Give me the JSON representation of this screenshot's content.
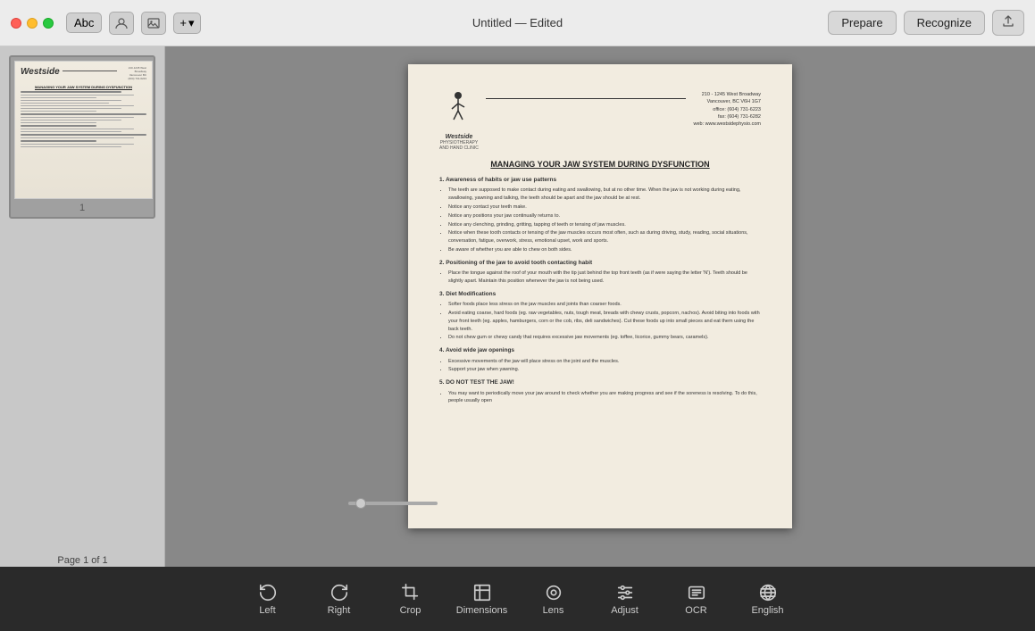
{
  "titlebar": {
    "title": "Untitled — Edited",
    "toolbar_text_btn": "Abc",
    "traffic_lights": [
      "close",
      "minimize",
      "maximize"
    ]
  },
  "header_buttons": {
    "prepare": "Prepare",
    "recognize": "Recognize",
    "share": "↑"
  },
  "document": {
    "title": "MANAGING YOUR JAW SYSTEM DURING DYSFUNCTION",
    "company": "Westside",
    "company_sub": "PHYSIOTHERAPY\nAND HAND CLINIC",
    "address_line1": "210 - 1245 West Broadway",
    "address_line2": "Vancouver, BC V6H 1G7",
    "address_line3": "office: (604) 731-6223",
    "address_line4": "fax: (604) 731-6282",
    "address_line5": "web: www.westsidephysio.com",
    "section1_title": "1. Awareness of habits or jaw use patterns",
    "section1_bullets": [
      "The teeth are supposed to make contact during eating and swallowing, but at no other time. When the jaw is not working during eating, swallowing, yawning and talking, the teeth should be apart and the jaw should be at rest.",
      "Notice any contact your teeth make.",
      "Notice any positions your jaw continually returns to.",
      "Notice any clenching, grinding, gritting, tapping of teeth or tensing of jaw muscles.",
      "Notice when these tooth contacts or tensing of the jaw muscles occurs most often, such as during driving, study, reading, social situations, conversation, fatigue, overwork, stress, emotional upset, work and sports.",
      "Be aware of whether you are able to chew on both sides."
    ],
    "section2_title": "2. Positioning of the jaw to avoid tooth contacting habit",
    "section2_bullets": [
      "Place the tongue against the roof of your mouth with the tip just behind the top front teeth (as if were saying the letter 'N'). Teeth should be slightly apart. Maintain this position whenever the jaw is not being used."
    ],
    "section3_title": "3. Diet Modifications",
    "section3_bullets": [
      "Softer foods place less stress on the jaw muscles and joints than coarser foods.",
      "Avoid eating coarse, hard foods (eg. raw vegetables, nuts, tough meat, breads with chewy crusts, popcorn, nachos). Avoid biting into foods with your front teeth (eg. apples, hamburgers, corn or the cob, ribs, deli sandwiches). Cut these foods up into small pieces and eat them using the back teeth.",
      "Do not chew gum or chewy candy that requires excessive jaw movements (eg. toffee, licorice, gummy bears, caramels)."
    ],
    "section4_title": "4. Avoid wide jaw openings",
    "section4_bullets": [
      "Excessive movements of the jaw will place stress on the joint and the muscles.",
      "Support your jaw when yawning."
    ],
    "section5_title": "5. DO NOT TEST THE JAW!",
    "section5_bullets": [
      "You may want to periodically move your jaw around to check whether you are making progress and see if the soreness is resolving. To do this, people usually open"
    ]
  },
  "sidebar": {
    "page_num": "1",
    "page_info": "Page 1 of 1"
  },
  "bottom_toolbar": {
    "items": [
      {
        "id": "left",
        "label": "Left",
        "icon": "rotate-left"
      },
      {
        "id": "right",
        "label": "Right",
        "icon": "rotate-right"
      },
      {
        "id": "crop",
        "label": "Crop",
        "icon": "crop"
      },
      {
        "id": "dimensions",
        "label": "Dimensions",
        "icon": "dimensions"
      },
      {
        "id": "lens",
        "label": "Lens",
        "icon": "lens"
      },
      {
        "id": "adjust",
        "label": "Adjust",
        "icon": "adjust"
      },
      {
        "id": "ocr",
        "label": "OCR",
        "icon": "ocr"
      },
      {
        "id": "english",
        "label": "English",
        "icon": "globe"
      }
    ]
  }
}
